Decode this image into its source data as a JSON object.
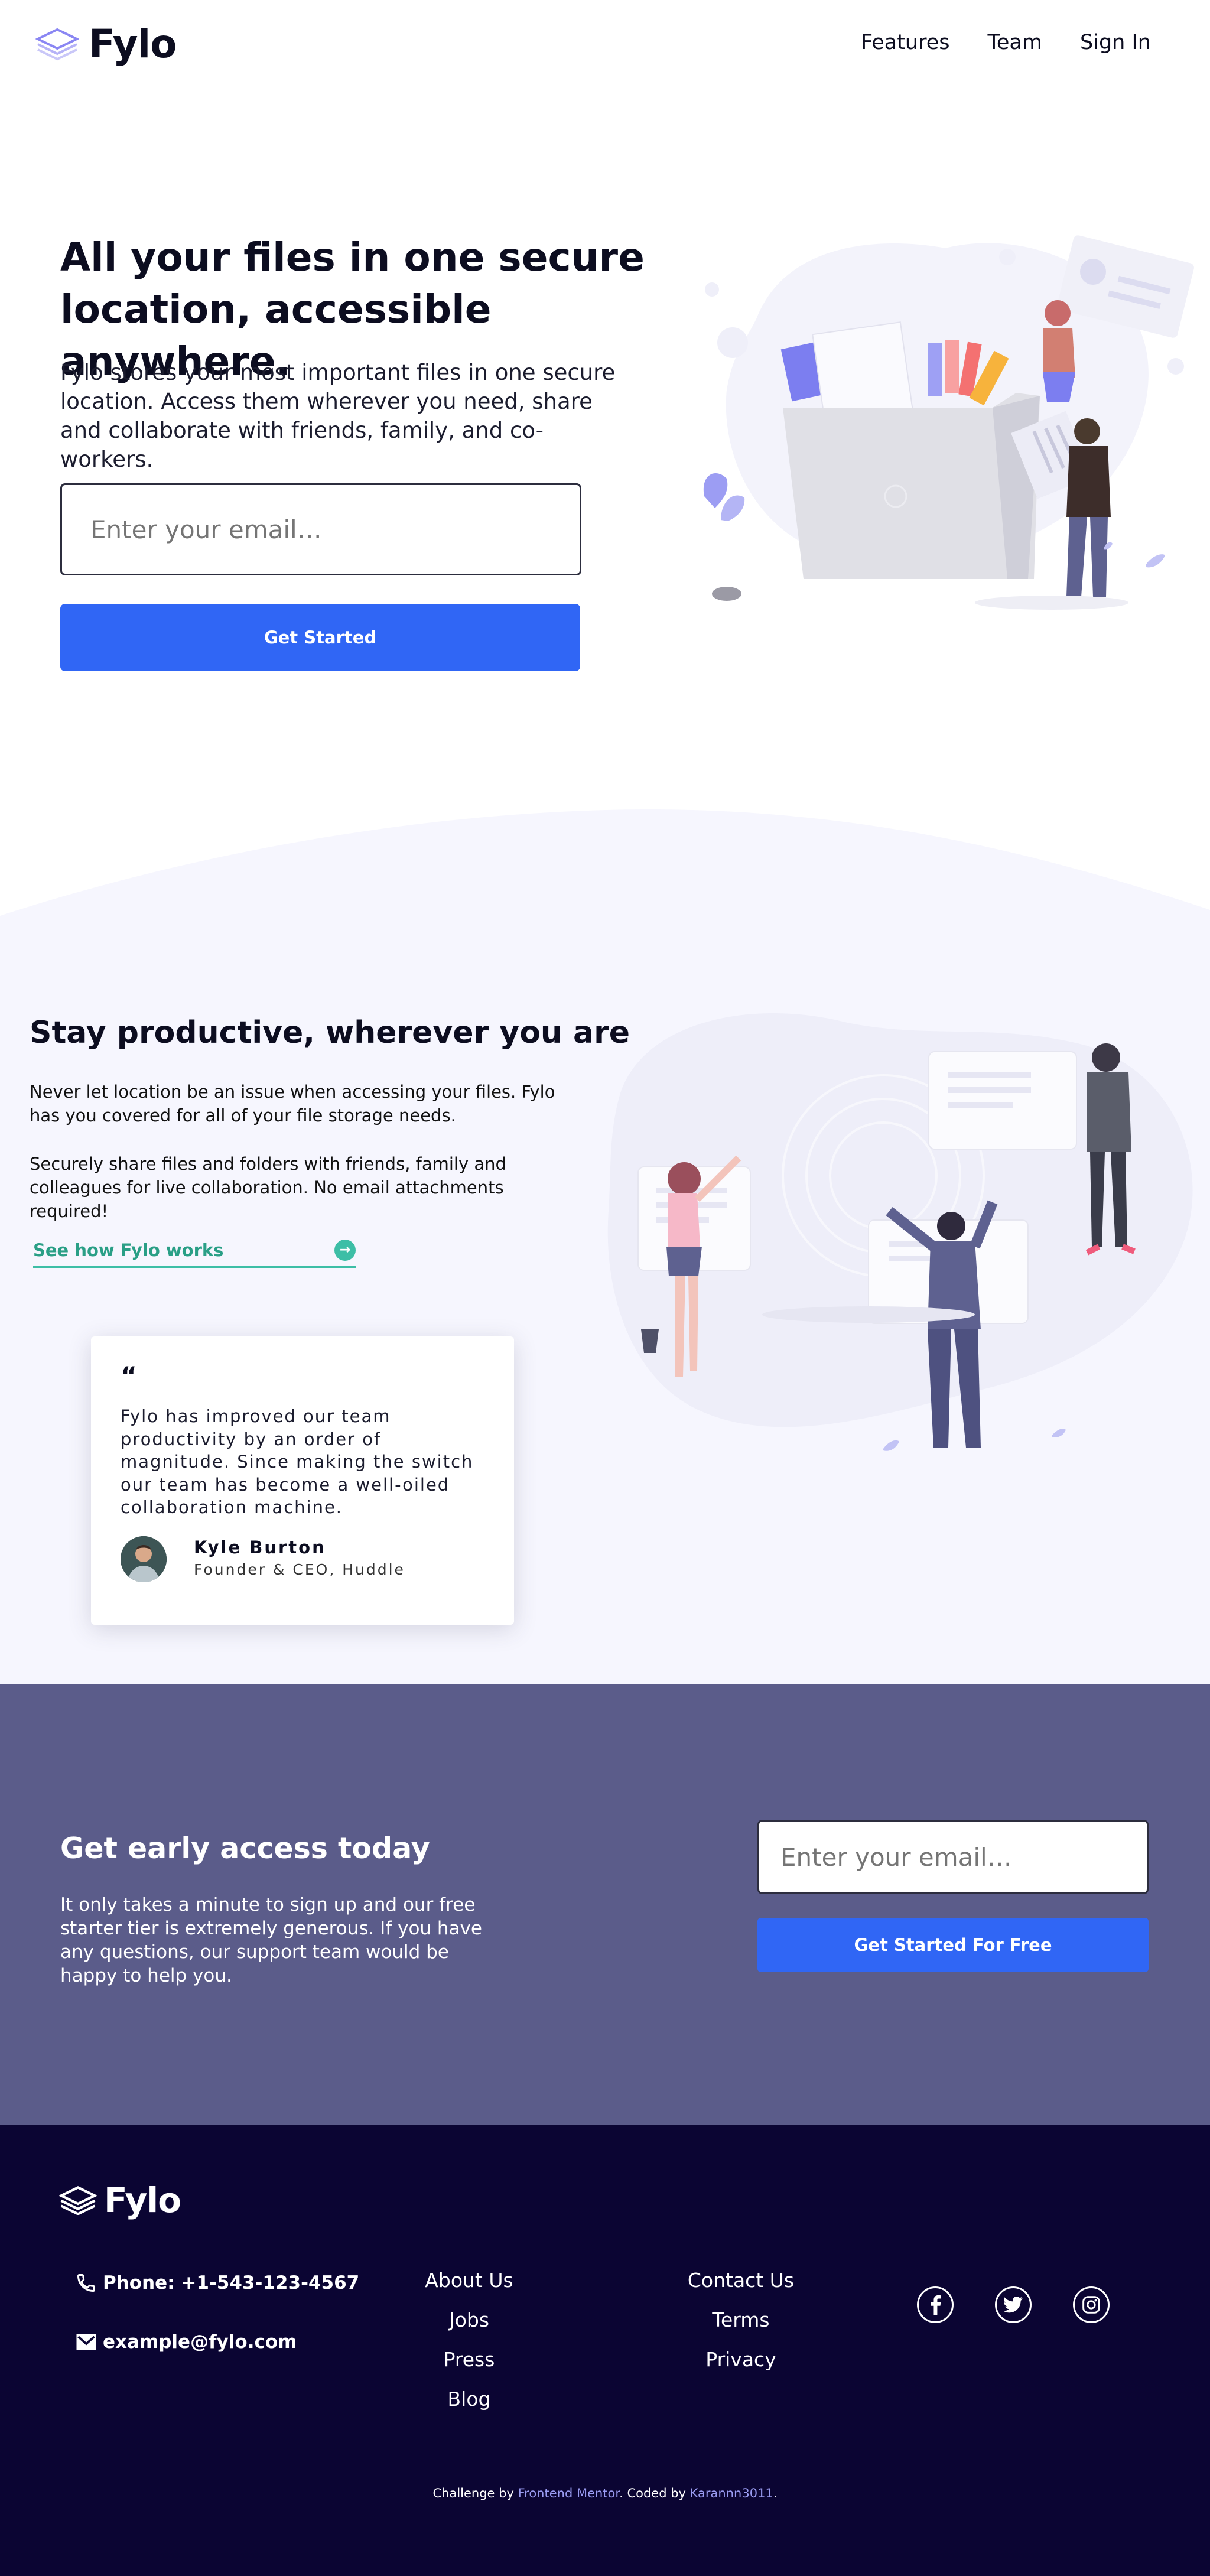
{
  "header": {
    "logo_text": "Fylo",
    "nav": [
      "Features",
      "Team",
      "Sign In"
    ]
  },
  "hero": {
    "title": "All your files in one secure location, accessible anywhere.",
    "description": "Fylo stores your most important files in one secure location. Access them wherever you need, share and collaborate with friends, family, and co-workers.",
    "email_placeholder": "Enter your email…",
    "button": "Get Started"
  },
  "productive": {
    "title": "Stay productive, wherever you are",
    "paragraph_1": "Never let location be an issue when accessing your files. Fylo has you covered for all of your file storage needs.",
    "paragraph_2": "Securely share files and folders with friends, family and colleagues for live collaboration. No email attachments required!",
    "link": "See how Fylo works"
  },
  "testimonial": {
    "quote_mark": "“",
    "quote": "Fylo has improved our team productivity by an order of magnitude. Since making the switch our team has become a well-oiled collaboration machine.",
    "name": "Kyle Burton",
    "role": "Founder & CEO, Huddle"
  },
  "early_access": {
    "title": "Get early access today",
    "description": "It only takes a minute to sign up and our free starter tier is extremely generous. If you have any questions, our support team would be happy to help you.",
    "email_placeholder": "Enter your email…",
    "button": "Get Started For Free"
  },
  "footer": {
    "logo_text": "Fylo",
    "phone": "Phone: +1-543-123-4567",
    "email": "example@fylo.com",
    "col1": [
      "About Us",
      "Jobs",
      "Press",
      "Blog"
    ],
    "col2": [
      "Contact Us",
      "Terms",
      "Privacy"
    ],
    "socials": [
      "facebook-icon",
      "twitter-icon",
      "instagram-icon"
    ],
    "credit": {
      "prefix": "Challenge by ",
      "link1": "Frontend Mentor",
      "middle": ". Coded by ",
      "link2": "Karannn3011",
      "suffix": "."
    }
  },
  "colors": {
    "primary_blue": "#3066f5",
    "teal": "#3dbea6",
    "early_access_bg": "#5b5c8a",
    "footer_bg": "#0b0533",
    "section_bg": "#f6f6fe"
  }
}
